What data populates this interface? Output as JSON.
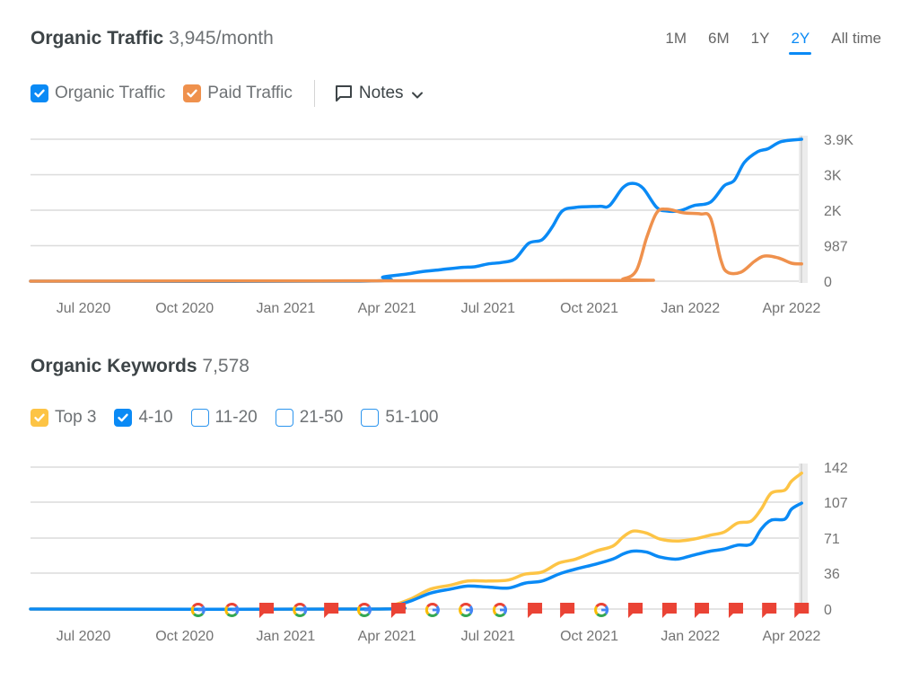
{
  "traffic": {
    "title": "Organic Traffic",
    "value": "3,945/month",
    "ranges": [
      {
        "label": "1M",
        "active": false
      },
      {
        "label": "6M",
        "active": false
      },
      {
        "label": "1Y",
        "active": false
      },
      {
        "label": "2Y",
        "active": true
      },
      {
        "label": "All time",
        "active": false
      }
    ],
    "legend": [
      {
        "label": "Organic Traffic",
        "checked": true,
        "color": "#0a8af5"
      },
      {
        "label": "Paid Traffic",
        "checked": true,
        "color": "#ef914d"
      }
    ],
    "notes_label": "Notes"
  },
  "keywords": {
    "title": "Organic Keywords",
    "value": "7,578",
    "legend": [
      {
        "label": "Top 3",
        "checked": true,
        "color": "#fdc445"
      },
      {
        "label": "4-10",
        "checked": true,
        "color": "#0a8af5"
      },
      {
        "label": "11-20",
        "checked": false,
        "color": "#2d95ee"
      },
      {
        "label": "21-50",
        "checked": false,
        "color": "#2d95ee"
      },
      {
        "label": "51-100",
        "checked": false,
        "color": "#2d95ee"
      }
    ]
  },
  "chart_data": [
    {
      "type": "line",
      "title": "Organic Traffic",
      "x_unit": "months since Jul 2020",
      "x_range": [
        -1.57,
        21.3
      ],
      "xticks": [
        {
          "t": 0,
          "label": "Jul 2020"
        },
        {
          "t": 3,
          "label": "Oct 2020"
        },
        {
          "t": 6,
          "label": "Jan 2021"
        },
        {
          "t": 9,
          "label": "Apr 2021"
        },
        {
          "t": 12,
          "label": "Jul 2021"
        },
        {
          "t": 15,
          "label": "Oct 2021"
        },
        {
          "t": 18,
          "label": "Jan 2022"
        },
        {
          "t": 21,
          "label": "Apr 2022"
        }
      ],
      "yticks": [
        {
          "v": 0,
          "label": "0"
        },
        {
          "v": 987,
          "label": "987"
        },
        {
          "v": 1973,
          "label": "2K"
        },
        {
          "v": 2959,
          "label": "3K"
        },
        {
          "v": 3945,
          "label": "3.9K"
        }
      ],
      "ylim": [
        0,
        3945
      ],
      "grid": true,
      "series": [
        {
          "name": "Organic Traffic",
          "color": "#0a8af5",
          "points": [
            [
              -1.57,
              0
            ],
            [
              8.2,
              0
            ],
            [
              8.9,
              120
            ],
            [
              9.6,
              200
            ],
            [
              10.0,
              260
            ],
            [
              10.6,
              320
            ],
            [
              11.2,
              380
            ],
            [
              11.6,
              400
            ],
            [
              12.0,
              480
            ],
            [
              12.4,
              520
            ],
            [
              12.8,
              620
            ],
            [
              13.2,
              1050
            ],
            [
              13.6,
              1150
            ],
            [
              13.9,
              1500
            ],
            [
              14.2,
              1950
            ],
            [
              14.6,
              2050
            ],
            [
              15.3,
              2080
            ],
            [
              15.6,
              2100
            ],
            [
              16.0,
              2600
            ],
            [
              16.3,
              2720
            ],
            [
              16.6,
              2580
            ],
            [
              17.0,
              2050
            ],
            [
              17.3,
              1950
            ],
            [
              17.7,
              1960
            ],
            [
              18.1,
              2100
            ],
            [
              18.6,
              2200
            ],
            [
              19.0,
              2650
            ],
            [
              19.3,
              2800
            ],
            [
              19.6,
              3300
            ],
            [
              20.0,
              3600
            ],
            [
              20.3,
              3680
            ],
            [
              20.7,
              3880
            ],
            [
              21.3,
              3945
            ]
          ]
        },
        {
          "name": "Paid Traffic",
          "color": "#ef914d",
          "points": [
            [
              -1.57,
              0
            ],
            [
              15.5,
              20
            ],
            [
              16.0,
              60
            ],
            [
              16.4,
              300
            ],
            [
              16.7,
              1200
            ],
            [
              17.0,
              1900
            ],
            [
              17.3,
              2000
            ],
            [
              17.8,
              1900
            ],
            [
              18.3,
              1870
            ],
            [
              18.6,
              1750
            ],
            [
              18.9,
              600
            ],
            [
              19.1,
              250
            ],
            [
              19.5,
              250
            ],
            [
              19.9,
              550
            ],
            [
              20.2,
              700
            ],
            [
              20.6,
              650
            ],
            [
              21.0,
              500
            ],
            [
              21.3,
              480
            ]
          ]
        }
      ]
    },
    {
      "type": "line",
      "title": "Organic Keywords",
      "x_unit": "months since Jul 2020",
      "x_range": [
        -1.57,
        21.3
      ],
      "xticks": [
        {
          "t": 0,
          "label": "Jul 2020"
        },
        {
          "t": 3,
          "label": "Oct 2020"
        },
        {
          "t": 6,
          "label": "Jan 2021"
        },
        {
          "t": 9,
          "label": "Apr 2021"
        },
        {
          "t": 12,
          "label": "Jul 2021"
        },
        {
          "t": 15,
          "label": "Oct 2021"
        },
        {
          "t": 18,
          "label": "Jan 2022"
        },
        {
          "t": 21,
          "label": "Apr 2022"
        }
      ],
      "yticks": [
        {
          "v": 0,
          "label": "0"
        },
        {
          "v": 36,
          "label": "36"
        },
        {
          "v": 71,
          "label": "71"
        },
        {
          "v": 107,
          "label": "107"
        },
        {
          "v": 142,
          "label": "142"
        }
      ],
      "ylim": [
        0,
        142
      ],
      "grid": true,
      "series": [
        {
          "name": "Top 3",
          "color": "#fdc445",
          "points": [
            [
              -1.57,
              0
            ],
            [
              8.6,
              0
            ],
            [
              9.2,
              4
            ],
            [
              9.7,
              10
            ],
            [
              10.3,
              20
            ],
            [
              10.9,
              24
            ],
            [
              11.4,
              28
            ],
            [
              12.0,
              28
            ],
            [
              12.6,
              29
            ],
            [
              13.1,
              35
            ],
            [
              13.6,
              37
            ],
            [
              14.1,
              46
            ],
            [
              14.6,
              50
            ],
            [
              15.2,
              58
            ],
            [
              15.7,
              63
            ],
            [
              16.0,
              72
            ],
            [
              16.3,
              78
            ],
            [
              16.7,
              76
            ],
            [
              17.1,
              70
            ],
            [
              17.6,
              68
            ],
            [
              18.1,
              70
            ],
            [
              18.6,
              74
            ],
            [
              19.0,
              77
            ],
            [
              19.4,
              86
            ],
            [
              19.8,
              88
            ],
            [
              20.1,
              100
            ],
            [
              20.4,
              116
            ],
            [
              20.8,
              119
            ],
            [
              21.0,
              128
            ],
            [
              21.3,
              136
            ]
          ]
        },
        {
          "name": "4-10",
          "color": "#0a8af5",
          "points": [
            [
              -1.57,
              0
            ],
            [
              8.6,
              0
            ],
            [
              9.2,
              3
            ],
            [
              9.7,
              8
            ],
            [
              10.3,
              16
            ],
            [
              10.9,
              20
            ],
            [
              11.4,
              23
            ],
            [
              12.0,
              22
            ],
            [
              12.6,
              21
            ],
            [
              13.1,
              26
            ],
            [
              13.6,
              28
            ],
            [
              14.1,
              35
            ],
            [
              14.6,
              40
            ],
            [
              15.2,
              45
            ],
            [
              15.7,
              50
            ],
            [
              16.0,
              55
            ],
            [
              16.3,
              58
            ],
            [
              16.7,
              57
            ],
            [
              17.1,
              52
            ],
            [
              17.6,
              50
            ],
            [
              18.1,
              54
            ],
            [
              18.6,
              58
            ],
            [
              19.0,
              60
            ],
            [
              19.4,
              64
            ],
            [
              19.8,
              65
            ],
            [
              20.1,
              80
            ],
            [
              20.4,
              89
            ],
            [
              20.8,
              90
            ],
            [
              21.0,
              100
            ],
            [
              21.3,
              106
            ]
          ]
        }
      ],
      "markers": [
        {
          "t": 3.4,
          "type": "google-update"
        },
        {
          "t": 4.4,
          "type": "google-update"
        },
        {
          "t": 5.43,
          "type": "note"
        },
        {
          "t": 6.42,
          "type": "google-update"
        },
        {
          "t": 7.35,
          "type": "note"
        },
        {
          "t": 8.33,
          "type": "google-update"
        },
        {
          "t": 9.34,
          "type": "note"
        },
        {
          "t": 10.35,
          "type": "google-update"
        },
        {
          "t": 11.34,
          "type": "google-update"
        },
        {
          "t": 12.35,
          "type": "google-update"
        },
        {
          "t": 13.39,
          "type": "note"
        },
        {
          "t": 14.35,
          "type": "note"
        },
        {
          "t": 15.36,
          "type": "google-update"
        },
        {
          "t": 16.37,
          "type": "note"
        },
        {
          "t": 17.38,
          "type": "note"
        },
        {
          "t": 18.34,
          "type": "note"
        },
        {
          "t": 19.35,
          "type": "note"
        },
        {
          "t": 20.34,
          "type": "note"
        },
        {
          "t": 21.3,
          "type": "note"
        }
      ]
    }
  ]
}
